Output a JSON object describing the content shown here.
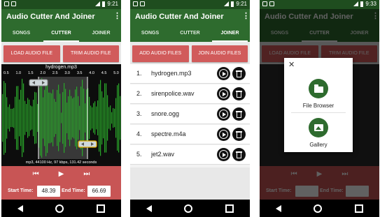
{
  "status": {
    "time1": "9:21",
    "time2": "9:21",
    "time3": "9:33"
  },
  "app": {
    "title": "Audio Cutter And Joiner"
  },
  "tabs": [
    "SONGS",
    "CUTTER",
    "JOINER"
  ],
  "cutter": {
    "load_label": "LOAD AUDIO FILE",
    "trim_label": "TRIM AUDIO FILE",
    "file_name": "hydrogen.mp3",
    "timeline": [
      "0.5",
      "1.0",
      "1.5",
      "2.0",
      "2.5",
      "3.0",
      "3.5",
      "4.0",
      "4.5",
      "5.0"
    ],
    "info": "mp3, 44100 Hz, 97 kbps, 131.42 seconds",
    "start_label": "Start Time:",
    "start_value": "48.39",
    "end_label": "End Time:",
    "end_value": "66.69"
  },
  "joiner": {
    "add_label": "ADD AUDIO FILES",
    "join_label": "JOIN AUDIO FILES",
    "files": [
      {
        "num": "1.",
        "name": "hydrogen.mp3"
      },
      {
        "num": "2.",
        "name": "sirenpolice.wav"
      },
      {
        "num": "3.",
        "name": "snore.ogg"
      },
      {
        "num": "4.",
        "name": "spectre.m4a"
      },
      {
        "num": "5.",
        "name": "jet2.wav"
      }
    ]
  },
  "picker": {
    "close": "✕",
    "file_browser": "File Browser",
    "gallery": "Gallery"
  },
  "colors": {
    "primary": "#2e6b2e",
    "accent": "#d15b5b",
    "wave": "#2aa62a"
  },
  "icons": {
    "play": "play-icon",
    "delete": "trash-icon",
    "folder": "folder-icon",
    "gallery": "image-icon"
  }
}
